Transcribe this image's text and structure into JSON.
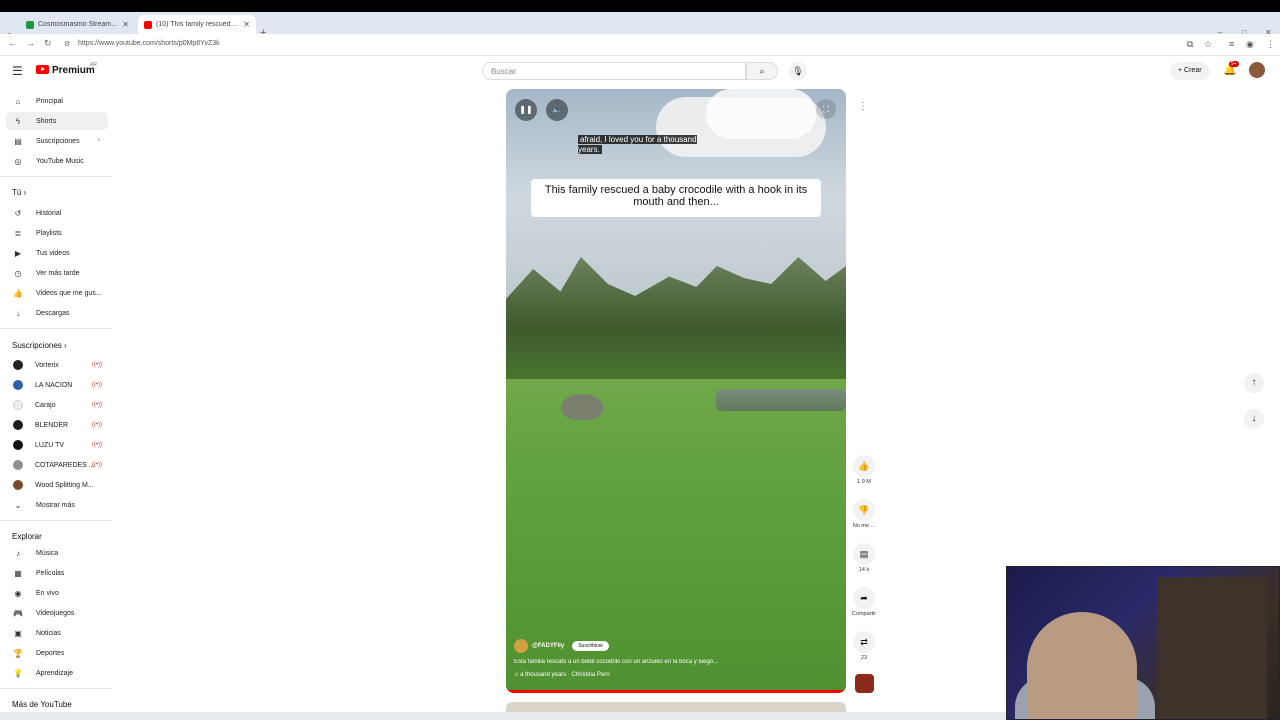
{
  "browser": {
    "tabs": [
      {
        "title": "Cosmosmasmo Stream - Watch",
        "active": false
      },
      {
        "title": "(10) This family rescued a b",
        "active": true
      }
    ],
    "url": "https://www.youtube.com/shorts/p0Mp8YvZ3k",
    "new_tab": "+",
    "window_controls": [
      "–",
      "□",
      "✕"
    ]
  },
  "header": {
    "logo_text": "Premium",
    "region": "AR",
    "search_placeholder": "Buscar",
    "create_label": "Crear",
    "notif_count": "9+"
  },
  "sidebar": {
    "main": [
      {
        "label": "Principal",
        "icon": "home-icon"
      },
      {
        "label": "Shorts",
        "icon": "shorts-icon",
        "selected": true
      },
      {
        "label": "Suscripciones",
        "icon": "subscriptions-icon"
      },
      {
        "label": "YouTube Music",
        "icon": "music-icon"
      }
    ],
    "you_title": "Tú",
    "you": [
      {
        "label": "Historial",
        "icon": "history-icon"
      },
      {
        "label": "Playlists",
        "icon": "playlist-icon"
      },
      {
        "label": "Tus videos",
        "icon": "your-videos-icon"
      },
      {
        "label": "Ver más tarde",
        "icon": "watch-later-icon"
      },
      {
        "label": "Videos que me gus...",
        "icon": "liked-icon"
      },
      {
        "label": "Descargas",
        "icon": "download-icon"
      }
    ],
    "subs_title": "Suscripciones",
    "subs": [
      {
        "label": "Vorterix",
        "color": "#222222"
      },
      {
        "label": "LA NACION",
        "color": "#2f5fa8"
      },
      {
        "label": "Carajo",
        "color": "#ffffff"
      },
      {
        "label": "BLENDER",
        "color": "#1e1e1e"
      },
      {
        "label": "LUZU TV",
        "color": "#111111"
      },
      {
        "label": "COTAPAREDES ...",
        "color": "#8f8f8f"
      },
      {
        "label": "Wood Splitting M...",
        "color": "#7a4a2a"
      }
    ],
    "show_more": "Mostrar más",
    "explore_title": "Explorar",
    "explore": [
      {
        "label": "Música",
        "icon": "music-note-icon"
      },
      {
        "label": "Películas",
        "icon": "film-icon"
      },
      {
        "label": "En vivo",
        "icon": "live-icon"
      },
      {
        "label": "Videojuegos",
        "icon": "gaming-icon"
      },
      {
        "label": "Noticias",
        "icon": "news-icon"
      },
      {
        "label": "Deportes",
        "icon": "sports-icon"
      },
      {
        "label": "Aprendizaje",
        "icon": "learning-icon"
      }
    ],
    "more_title": "Más de YouTube"
  },
  "short": {
    "subtitle": "afraid, I loved you for a thousand years.",
    "caption": "This family rescued a baby crocodile with a hook in its mouth and then...",
    "channel": "@FADYFily",
    "subscribe": "Suscribirse",
    "description": "Esta familia rescató a un bebé cocodrilo con un anzuelo en la boca y luego...",
    "music": "♫ a thousand years · Christina Perri",
    "progress_fraction": 1.0
  },
  "actions": {
    "like_count": "1.9 M",
    "dislike_label": "No me ...",
    "comments_count": "14 k",
    "share_label": "Compartir",
    "remix_count": "23"
  }
}
